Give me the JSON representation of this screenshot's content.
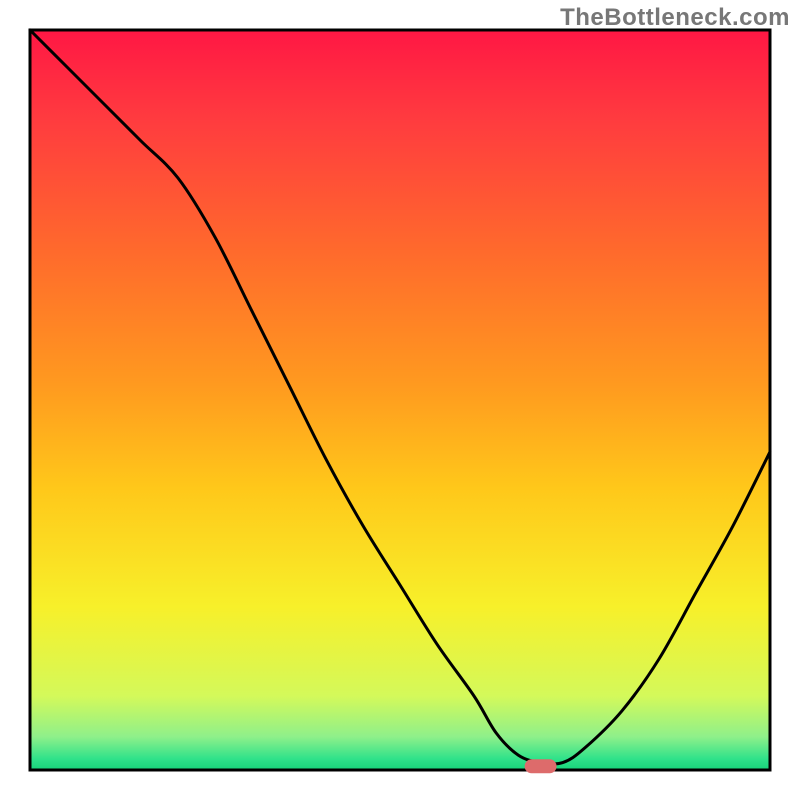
{
  "watermark": "TheBottleneck.com",
  "chart_data": {
    "type": "line",
    "title": "",
    "xlabel": "",
    "ylabel": "",
    "xlim": [
      0,
      100
    ],
    "ylim": [
      0,
      100
    ],
    "grid": false,
    "legend": false,
    "curve_note": "Single black curve plotting bottleneck percentage vs. some x axis; starts near top-left (high), descends steeply with a slight knee, bottoms out around x≈68 (minimum near y≈0) where a small red marker sits at the trough, then rises sharply toward the right edge.",
    "series": [
      {
        "name": "bottleneck-curve",
        "x": [
          0,
          5,
          10,
          15,
          20,
          25,
          30,
          35,
          40,
          45,
          50,
          55,
          60,
          63,
          66,
          69,
          72,
          75,
          80,
          85,
          90,
          95,
          100
        ],
        "y": [
          100,
          95,
          90,
          85,
          80,
          72,
          62,
          52,
          42,
          33,
          25,
          17,
          10,
          5,
          2,
          1,
          1,
          3,
          8,
          15,
          24,
          33,
          43
        ]
      }
    ],
    "marker": {
      "name": "optimal-point",
      "x": 69,
      "y": 0.5,
      "color": "#dd6b6b"
    },
    "background_gradient_stops": [
      {
        "offset": 0.0,
        "color": "#ff1744"
      },
      {
        "offset": 0.12,
        "color": "#ff3b3f"
      },
      {
        "offset": 0.3,
        "color": "#ff6a2c"
      },
      {
        "offset": 0.48,
        "color": "#ff9a1f"
      },
      {
        "offset": 0.62,
        "color": "#ffc81a"
      },
      {
        "offset": 0.78,
        "color": "#f7f02a"
      },
      {
        "offset": 0.9,
        "color": "#d4f95a"
      },
      {
        "offset": 0.955,
        "color": "#8ff08a"
      },
      {
        "offset": 0.985,
        "color": "#2fe28a"
      },
      {
        "offset": 1.0,
        "color": "#17d47a"
      }
    ]
  },
  "plot_geometry": {
    "outer_w": 800,
    "outer_h": 800,
    "inner_x": 30,
    "inner_y": 30,
    "inner_w": 740,
    "inner_h": 740
  }
}
